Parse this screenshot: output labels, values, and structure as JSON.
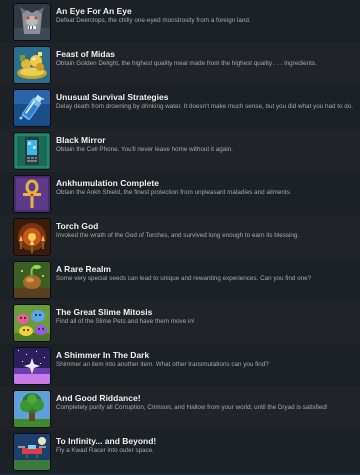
{
  "achievements": [
    {
      "icon": "werewolf-deerclops-icon",
      "title": "An Eye For An Eye",
      "description": "Defeat Deerclops, the chilly one-eyed monstrosity from a foreign land."
    },
    {
      "icon": "golden-feast-icon",
      "title": "Feast of Midas",
      "description": "Obtain Golden Delight, the highest quality meal made from the highest quality . . . ingredients."
    },
    {
      "icon": "water-bottle-icon",
      "title": "Unusual Survival Strategies",
      "description": "Delay death from drowning by drinking water. It doesn't make much sense, but you did what you had to do."
    },
    {
      "icon": "cell-phone-icon",
      "title": "Black Mirror",
      "description": "Obtain the Cell Phone. You'll never leave home without it again."
    },
    {
      "icon": "ankh-shield-icon",
      "title": "Ankhumulation Complete",
      "description": "Obtain the Ankh Shield, the finest protection from unpleasant maladies and ailments."
    },
    {
      "icon": "torch-god-icon",
      "title": "Torch God",
      "description": "Invoked the wrath of the God of Torches, and survived long enough to earn its blessing."
    },
    {
      "icon": "seed-icon",
      "title": "A Rare Realm",
      "description": "Some very special seeds can lead to unique and rewarding experiences. Can you find one?"
    },
    {
      "icon": "slime-pets-icon",
      "title": "The Great Slime Mitosis",
      "description": "Find all of the Slime Pets and have them move in!"
    },
    {
      "icon": "shimmer-icon",
      "title": "A Shimmer In The Dark",
      "description": "Shimmer an item into another item. What other transmutations can you find?"
    },
    {
      "icon": "tree-icon",
      "title": "And Good Riddance!",
      "description": "Completely purify all Corruption, Crimson, and Hallow from your world, until the Dryad is satisfied!"
    },
    {
      "icon": "kwad-racer-icon",
      "title": "To Infinity... and Beyond!",
      "description": "Fly a Kwad Racer into outer space."
    }
  ]
}
